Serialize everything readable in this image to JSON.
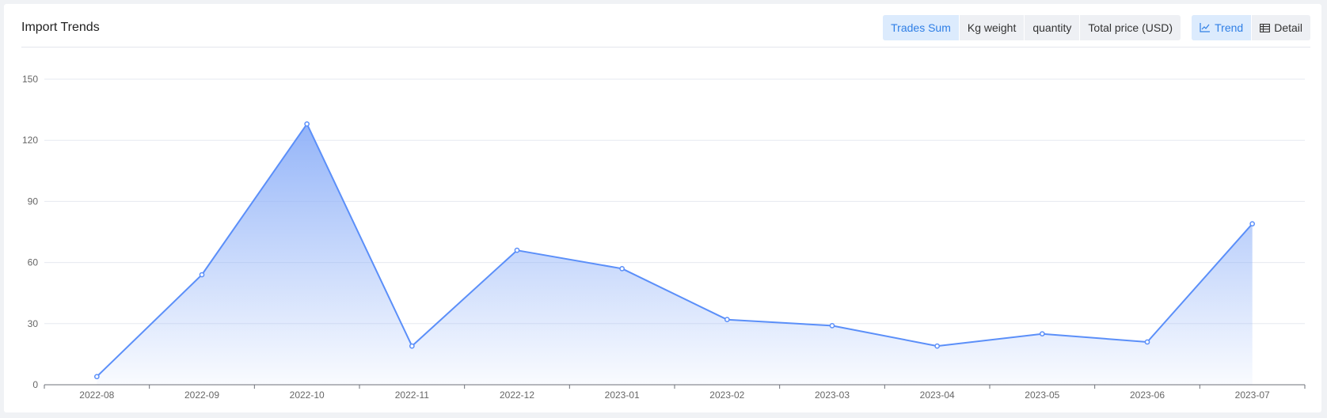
{
  "header": {
    "title": "Import Trends",
    "metric_tabs": [
      {
        "label": "Trades Sum",
        "active": true
      },
      {
        "label": "Kg weight",
        "active": false
      },
      {
        "label": "quantity",
        "active": false
      },
      {
        "label": "Total price (USD)",
        "active": false
      }
    ],
    "view_tabs": [
      {
        "label": "Trend",
        "icon": "line-chart-icon",
        "active": true
      },
      {
        "label": "Detail",
        "icon": "table-icon",
        "active": false
      }
    ]
  },
  "colors": {
    "line": "#5b8ff9",
    "area_top": "#8fb1f8",
    "active_tab_bg": "#dcebfd",
    "active_tab_text": "#2f7fe6"
  },
  "chart_data": {
    "type": "area",
    "title": "",
    "xlabel": "",
    "ylabel": "",
    "categories": [
      "2022-08",
      "2022-09",
      "2022-10",
      "2022-11",
      "2022-12",
      "2023-01",
      "2023-02",
      "2023-03",
      "2023-04",
      "2023-05",
      "2023-06",
      "2023-07"
    ],
    "series": [
      {
        "values": [
          4,
          54,
          128,
          19,
          66,
          57,
          32,
          29,
          19,
          25,
          21,
          79
        ]
      }
    ],
    "yticks": [
      "0",
      "30",
      "60",
      "90",
      "120",
      "150"
    ],
    "ylim": [
      0,
      150
    ],
    "grid": true
  }
}
